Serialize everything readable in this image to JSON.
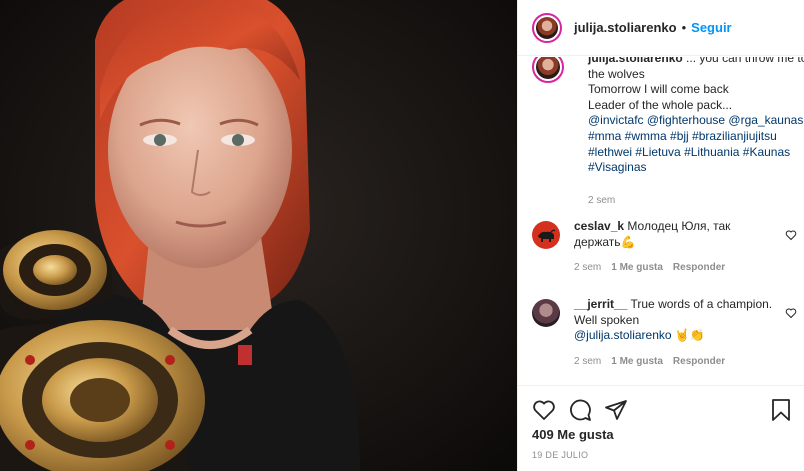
{
  "header": {
    "username": "julija.stoliarenko",
    "dot": "•",
    "follow_label": "Seguir"
  },
  "caption": {
    "username": "julija.stoliarenko",
    "lines": [
      "... you can throw me to the wolves",
      "Tomorrow I will come back",
      "Leader of the whole pack..."
    ],
    "tags": [
      "@invictafc @fighterhouse @rga_kaunas",
      "#mma #wmma #bjj #brazilianjiujitsu",
      "#lethwei #Lietuva #Lithuania #Kaunas",
      "#Visaginas"
    ],
    "time": "2 sem"
  },
  "comments": [
    {
      "username": "ceslav_k",
      "text": "Молодец Юля, так держать",
      "emoji": "💪",
      "time": "2 sem",
      "likes": "1 Me gusta",
      "reply": "Responder"
    },
    {
      "username": "__jerrit__",
      "text": "True words of a champion. Well spoken",
      "mention": "@julija.stoliarenko",
      "emoji": "🤘👏",
      "time": "2 sem",
      "likes": "1 Me gusta",
      "reply": "Responder"
    }
  ],
  "likes_count": "409 Me gusta",
  "date": "19 DE JULIO",
  "icons": [
    "heart-icon",
    "comment-icon",
    "share-icon",
    "bookmark-icon"
  ],
  "colors": {
    "link": "#0095f6",
    "mention": "#00376b",
    "muted": "#8e8e8e",
    "text": "#262626"
  }
}
